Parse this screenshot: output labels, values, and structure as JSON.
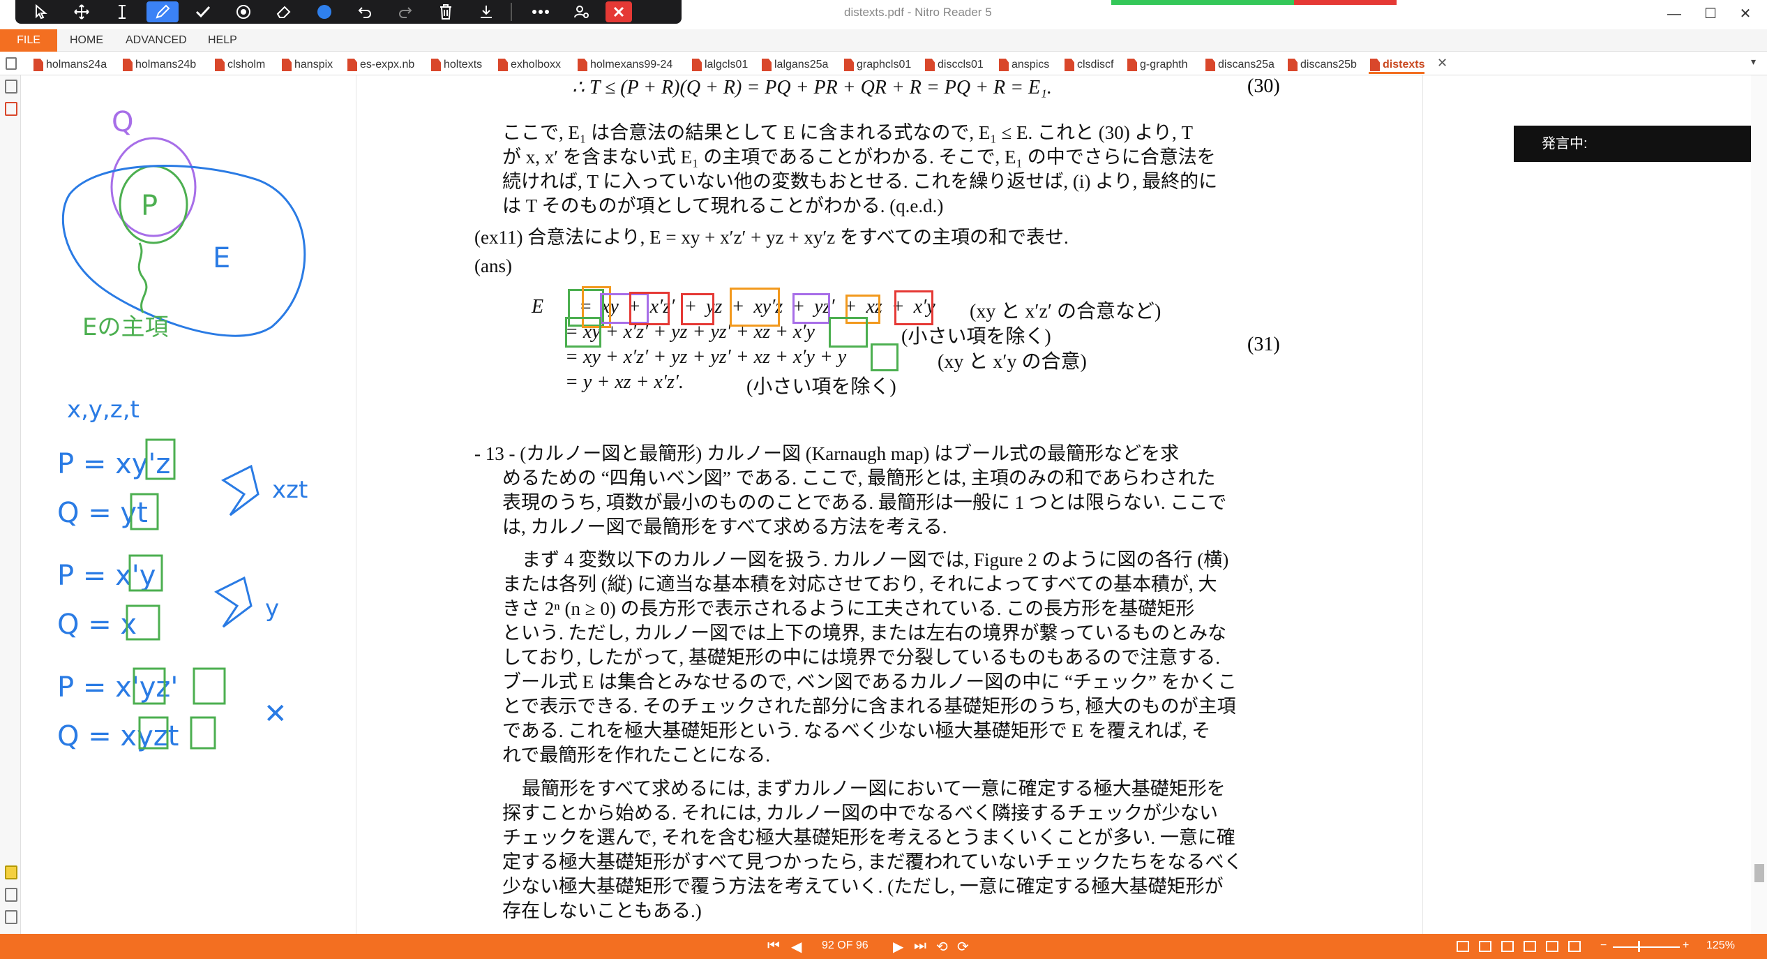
{
  "window": {
    "title": "distexts.pdf - Nitro Reader 5",
    "minimize": "—",
    "maximize": "☐",
    "close": "✕"
  },
  "annot_toolbar": {
    "icons": [
      "cursor-icon",
      "move-icon",
      "text-cursor-icon",
      "pen-icon",
      "check-icon",
      "stamp-icon",
      "eraser-icon",
      "color-dot-icon",
      "undo-icon",
      "redo-icon",
      "delete-icon",
      "download-icon",
      "more-icon",
      "user-settings-icon",
      "close-icon"
    ],
    "accent": "#3b82f6",
    "close_color": "#e53935"
  },
  "ribbon": {
    "file": "FILE",
    "home": "HOME",
    "advanced": "ADVANCED",
    "help": "HELP",
    "accent": "#f36f21"
  },
  "tabs": [
    "holmans24a",
    "holmans24b",
    "clsholm",
    "hanspix",
    "es-expx.nb",
    "holtexts",
    "exholboxx",
    "holmexans99-24",
    "lalgcls01",
    "lalgans25a",
    "graphcls01",
    "disccls01",
    "anspics",
    "clsdiscf",
    "g-graphth",
    "discans25a",
    "discans25b",
    "distexts"
  ],
  "active_tab": "distexts",
  "handwriting": {
    "q": "Q",
    "p": "P",
    "e": "E",
    "caption": "Eの主項",
    "vars": "x,y,z,t",
    "r1": "P = xy'z",
    "r2": "Q = yt",
    "r3": "P = x'y",
    "r4": "Q = x",
    "r5": "P = x'yz'",
    "r6": "Q = xyzt",
    "out1": "xzt",
    "out2": "y",
    "cross": "✕"
  },
  "doc": {
    "eq30": "∴  T ≤ (P + R)(Q + R) = PQ + PR + QR + R = PQ + R = E₁.",
    "eq30_num": "(30)",
    "p1": [
      "ここで, E₁ は合意法の結果として E に含まれる式なので, E₁ ≤ E. これと (30) より, T",
      "が x, x′ を含まない式 E₁ の主項であることがわかる. そこで, E₁ の中でさらに合意法を",
      "続ければ, T に入っていない他の変数もおとせる. これを繰り返せば, (i) より, 最終的に",
      "は T そのものが項として現れることがわかる. (q.e.d.)"
    ],
    "ex11": "(ex11)  合意法により, E = xy + x′z′ + yz + xy′z をすべての主項の和で表せ.",
    "ans": "(ans)",
    "eq_lhs": "E",
    "eq_lines": [
      "=  xy + x′z′ + yz + xy′z + yz′ + xz + x′y",
      "= xy + x′z′ + yz + yz′ + xz + x′y",
      "= xy + x′z′ + yz + yz′ + xz + x′y + y",
      "= y + xz + x′z′."
    ],
    "eq_notes": [
      "(xy と x′z′ の合意など)",
      "(小さい項を除く)",
      "(xy と x′y の合意)",
      "(小さい項を除く)"
    ],
    "eq31_num": "(31)",
    "sec13": [
      "- 13 - (カルノー図と最簡形) カルノー図 (Karnaugh map) はブール式の最簡形などを求",
      "めるための “四角いベン図” である. ここで, 最簡形とは, 主項のみの和であらわされた",
      "表現のうち, 項数が最小のもののことである. 最簡形は一般に 1 つとは限らない. ここで",
      "は, カルノー図で最簡形をすべて求める方法を考える."
    ],
    "p2": [
      "まず 4 変数以下のカルノー図を扱う. カルノー図では, Figure 2 のように図の各行 (横)",
      "または各列 (縦) に適当な基本積を対応させており, それによってすべての基本積が, 大",
      "きさ 2ⁿ (n ≥ 0) の長方形で表示されるように工夫されている. この長方形を基礎矩形",
      "という. ただし, カルノー図では上下の境界, または左右の境界が繋っているものとみな",
      "しており, したがって, 基礎矩形の中には境界で分裂しているものもあるので注意する.",
      "ブール式 E は集合とみなせるので, ベン図であるカルノー図の中に “チェック” をかくこ",
      "とで表示できる. そのチェックされた部分に含まれる基礎矩形のうち, 極大のものが主項",
      "である. これを極大基礎矩形という. なるべく少ない極大基礎矩形で E を覆えれば, そ",
      "れで最簡形を作れたことになる."
    ],
    "p3": [
      "最簡形をすべて求めるには, まずカルノー図において一意に確定する極大基礎矩形を",
      "探すことから始める. それには, カルノー図の中でなるべく隣接するチェックが少ない",
      "チェックを選んで, それを含む極大基礎矩形を考えるとうまくいくことが多い. 一意に確",
      "定する極大基礎矩形がすべて見つかったら, まだ覆われていないチェックたちをなるべく",
      "少ない極大基礎矩形で覆う方法を考えていく. (ただし, 一意に確定する極大基礎矩形が",
      "存在しないこともある.)"
    ]
  },
  "speech": "発言中:",
  "status": {
    "page": "92 OF 96",
    "zoom_minus": "−",
    "zoom_plus": "+",
    "zoom": "125%"
  }
}
